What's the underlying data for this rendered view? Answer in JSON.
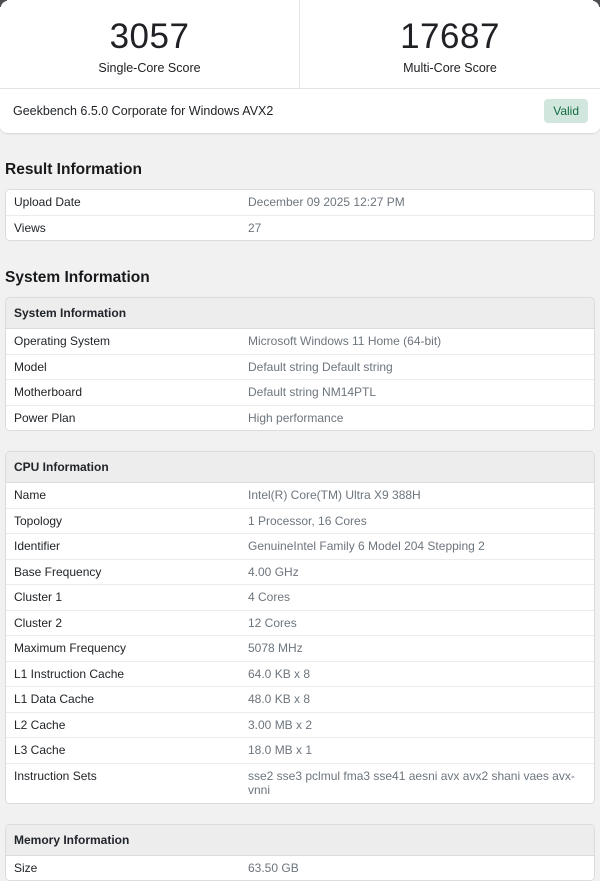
{
  "score_banner": {
    "single_core": {
      "value": "3057",
      "label": "Single-Core Score"
    },
    "multi_core": {
      "value": "17687",
      "label": "Multi-Core Score"
    },
    "version_text": "Geekbench 6.5.0 Corporate for Windows AVX2",
    "badge_label": "Valid",
    "badge_bg_color": "#d1e7dd",
    "badge_text_color": "#146c43"
  },
  "result_information": {
    "heading": "Result Information",
    "rows": [
      {
        "label": "Upload Date",
        "value": "December 09 2025 12:27 PM"
      },
      {
        "label": "Views",
        "value": "27"
      }
    ]
  },
  "system_information": {
    "heading": "System Information",
    "cards": [
      {
        "title": "System Information",
        "rows": [
          {
            "label": "Operating System",
            "value": "Microsoft Windows 11 Home (64-bit)"
          },
          {
            "label": "Model",
            "value": "Default string Default string"
          },
          {
            "label": "Motherboard",
            "value": "Default string NM14PTL"
          },
          {
            "label": "Power Plan",
            "value": "High performance"
          }
        ]
      },
      {
        "title": "CPU Information",
        "rows": [
          {
            "label": "Name",
            "value": "Intel(R) Core(TM) Ultra X9 388H"
          },
          {
            "label": "Topology",
            "value": "1 Processor, 16 Cores"
          },
          {
            "label": "Identifier",
            "value": "GenuineIntel Family 6 Model 204 Stepping 2"
          },
          {
            "label": "Base Frequency",
            "value": "4.00 GHz"
          },
          {
            "label": "Cluster 1",
            "value": "4 Cores"
          },
          {
            "label": "Cluster 2",
            "value": "12 Cores"
          },
          {
            "label": "Maximum Frequency",
            "value": "5078 MHz"
          },
          {
            "label": "L1 Instruction Cache",
            "value": "64.0 KB x 8"
          },
          {
            "label": "L1 Data Cache",
            "value": "48.0 KB x 8"
          },
          {
            "label": "L2 Cache",
            "value": "3.00 MB x 2"
          },
          {
            "label": "L3 Cache",
            "value": "18.0 MB x 1"
          },
          {
            "label": "Instruction Sets",
            "value": "sse2 sse3 pclmul fma3 sse41 aesni avx avx2 shani vaes avx-vnni"
          }
        ]
      },
      {
        "title": "Memory Information",
        "rows": [
          {
            "label": "Size",
            "value": "63.50 GB"
          }
        ]
      }
    ]
  }
}
